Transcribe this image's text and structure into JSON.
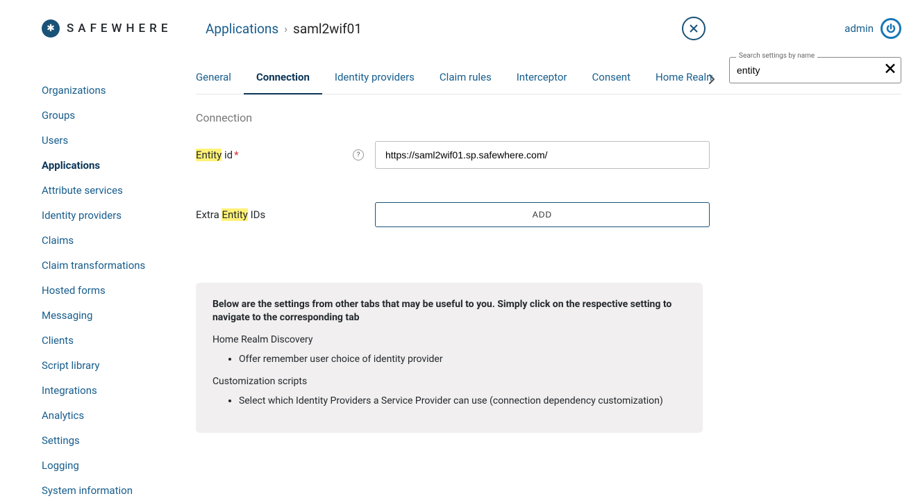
{
  "brand": {
    "name": "SAFEWHERE"
  },
  "user": {
    "name": "admin"
  },
  "breadcrumb": {
    "root": "Applications",
    "separator": "›",
    "current": "saml2wif01"
  },
  "search": {
    "label": "Search settings by name",
    "value": "entity"
  },
  "sidebar": {
    "items": [
      {
        "key": "organizations",
        "label": "Organizations",
        "active": false
      },
      {
        "key": "groups",
        "label": "Groups",
        "active": false
      },
      {
        "key": "users",
        "label": "Users",
        "active": false
      },
      {
        "key": "applications",
        "label": "Applications",
        "active": true
      },
      {
        "key": "attribute-services",
        "label": "Attribute services",
        "active": false
      },
      {
        "key": "identity-providers",
        "label": "Identity providers",
        "active": false
      },
      {
        "key": "claims",
        "label": "Claims",
        "active": false
      },
      {
        "key": "claim-transformations",
        "label": "Claim transformations",
        "active": false
      },
      {
        "key": "hosted-forms",
        "label": "Hosted forms",
        "active": false
      },
      {
        "key": "messaging",
        "label": "Messaging",
        "active": false
      },
      {
        "key": "clients",
        "label": "Clients",
        "active": false
      },
      {
        "key": "script-library",
        "label": "Script library",
        "active": false
      },
      {
        "key": "integrations",
        "label": "Integrations",
        "active": false
      },
      {
        "key": "analytics",
        "label": "Analytics",
        "active": false
      },
      {
        "key": "settings",
        "label": "Settings",
        "active": false
      },
      {
        "key": "logging",
        "label": "Logging",
        "active": false
      },
      {
        "key": "system-information",
        "label": "System information",
        "active": false
      }
    ]
  },
  "tabs": [
    {
      "key": "general",
      "label": "General",
      "active": false
    },
    {
      "key": "connection",
      "label": "Connection",
      "active": true
    },
    {
      "key": "identity-providers",
      "label": "Identity providers",
      "active": false
    },
    {
      "key": "claim-rules",
      "label": "Claim rules",
      "active": false
    },
    {
      "key": "interceptor",
      "label": "Interceptor",
      "active": false
    },
    {
      "key": "consent",
      "label": "Consent",
      "active": false
    },
    {
      "key": "home-realm",
      "label": "Home Realm",
      "active": false,
      "truncated": true
    }
  ],
  "section": {
    "title": "Connection"
  },
  "fields": {
    "entity_id": {
      "label_pre": "Entity",
      "label_post": " id",
      "required": "*",
      "value": "https://saml2wif01.sp.safewhere.com/"
    },
    "extra_entity_ids": {
      "label_pre": "Extra ",
      "label_hl": "Entity",
      "label_post": " IDs",
      "button": "ADD"
    }
  },
  "infobox": {
    "heading": "Below are the settings from other tabs that may be useful to you. Simply click on the respective setting to navigate to the corresponding tab",
    "sections": [
      {
        "title": "Home Realm Discovery",
        "items": [
          "Offer remember user choice of identity provider"
        ]
      },
      {
        "title": "Customization scripts",
        "items": [
          "Select which Identity Providers a Service Provider can use (connection dependency customization)"
        ]
      }
    ]
  }
}
